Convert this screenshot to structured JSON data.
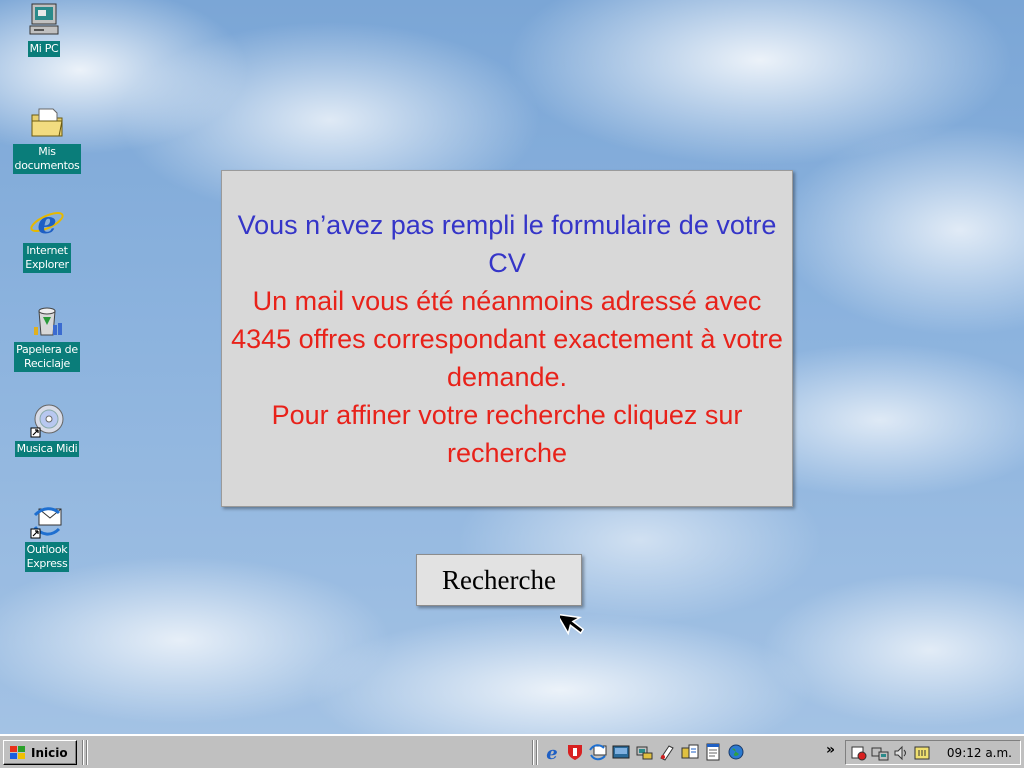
{
  "desktop": {
    "icons": [
      {
        "label": "Mi PC",
        "icon": "computer-icon"
      },
      {
        "label": "Mis\ndocumentos",
        "icon": "folder-icon"
      },
      {
        "label": "Internet\nExplorer",
        "icon": "internet-explorer-icon"
      },
      {
        "label": "Papelera de\nReciclaje",
        "icon": "recycle-bin-icon"
      },
      {
        "label": "Musica Midi",
        "icon": "cd-icon"
      },
      {
        "label": "Outlook\nExpress",
        "icon": "outlook-express-icon"
      }
    ]
  },
  "message": {
    "line1": "Vous n’avez pas rempli le formulaire de votre CV",
    "line2": "Un mail vous été néanmoins adressé avec 4345 offres correspondant exactement à votre demande.",
    "line3": "Pour affiner votre recherche cliquez sur recherche"
  },
  "button": {
    "label": "Recherche"
  },
  "taskbar": {
    "start_label": "Inicio",
    "chevron": "»",
    "clock": "09:12 a.m."
  },
  "colors": {
    "message_blue": "#3535c8",
    "message_red": "#e8221a",
    "label_bg": "#0a7d7a",
    "taskbar": "#c0c0c0"
  }
}
